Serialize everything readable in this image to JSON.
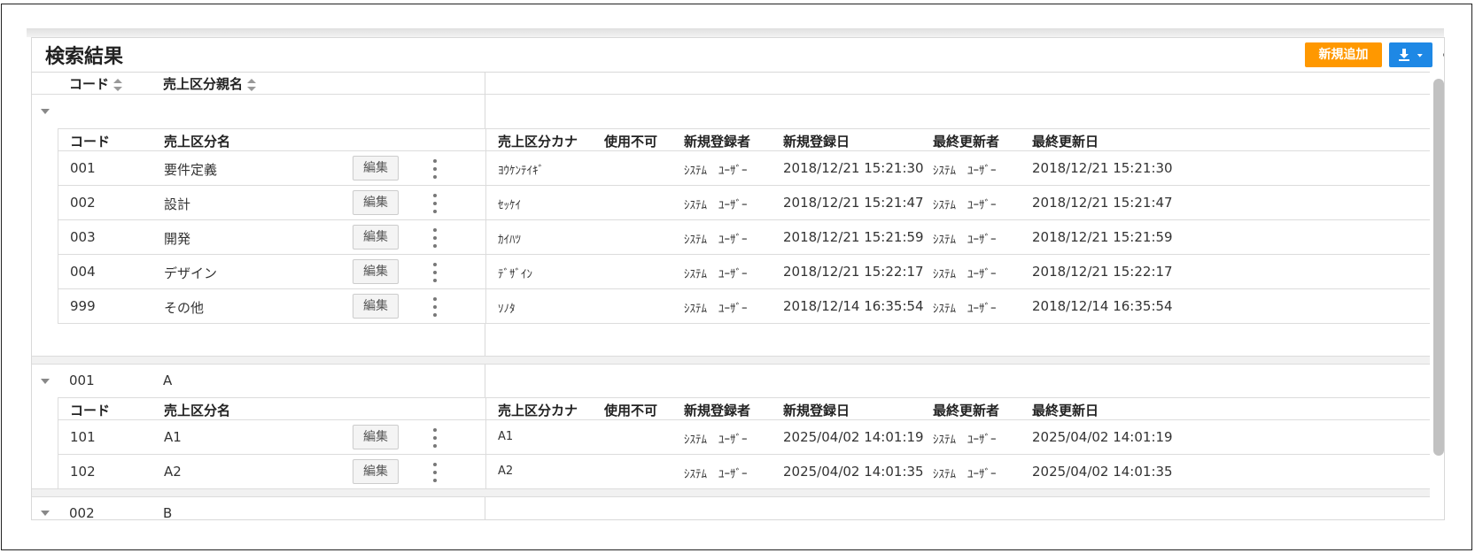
{
  "panel": {
    "title": "検索結果",
    "new_button": "新規追加",
    "download_icon": "download-icon",
    "settings_icon": "gear-icon"
  },
  "master_header": {
    "code": "コード",
    "name": "売上区分親名"
  },
  "detail_header": {
    "code": "コード",
    "name": "売上区分名",
    "kana": "売上区分カナ",
    "disabled": "使用不可",
    "creator": "新規登録者",
    "created": "新規登録日",
    "updater": "最終更新者",
    "updated": "最終更新日"
  },
  "edit_label": "編集",
  "groups": [
    {
      "code": "",
      "name": "",
      "rows": [
        {
          "code": "001",
          "name": "要件定義",
          "kana": "ﾖｳｹﾝﾃｲｷﾞ",
          "creator": "ｼｽﾃﾑ　ﾕｰｻﾞｰ",
          "created": "2018/12/21 15:21:30",
          "updater": "ｼｽﾃﾑ　ﾕｰｻﾞｰ",
          "updated": "2018/12/21 15:21:30"
        },
        {
          "code": "002",
          "name": "設計",
          "kana": "ｾｯｹｲ",
          "creator": "ｼｽﾃﾑ　ﾕｰｻﾞｰ",
          "created": "2018/12/21 15:21:47",
          "updater": "ｼｽﾃﾑ　ﾕｰｻﾞｰ",
          "updated": "2018/12/21 15:21:47"
        },
        {
          "code": "003",
          "name": "開発",
          "kana": "ｶｲﾊﾂ",
          "creator": "ｼｽﾃﾑ　ﾕｰｻﾞｰ",
          "created": "2018/12/21 15:21:59",
          "updater": "ｼｽﾃﾑ　ﾕｰｻﾞｰ",
          "updated": "2018/12/21 15:21:59"
        },
        {
          "code": "004",
          "name": "デザイン",
          "kana": "ﾃﾞｻﾞｲﾝ",
          "creator": "ｼｽﾃﾑ　ﾕｰｻﾞｰ",
          "created": "2018/12/21 15:22:17",
          "updater": "ｼｽﾃﾑ　ﾕｰｻﾞｰ",
          "updated": "2018/12/21 15:22:17"
        },
        {
          "code": "999",
          "name": "その他",
          "kana": "ｿﾉﾀ",
          "creator": "ｼｽﾃﾑ　ﾕｰｻﾞｰ",
          "created": "2018/12/14 16:35:54",
          "updater": "ｼｽﾃﾑ　ﾕｰｻﾞｰ",
          "updated": "2018/12/14 16:35:54"
        }
      ]
    },
    {
      "code": "001",
      "name": "A",
      "rows": [
        {
          "code": "101",
          "name": "A1",
          "kana": "A1",
          "creator": "ｼｽﾃﾑ　ﾕｰｻﾞｰ",
          "created": "2025/04/02 14:01:19",
          "updater": "ｼｽﾃﾑ　ﾕｰｻﾞｰ",
          "updated": "2025/04/02 14:01:19"
        },
        {
          "code": "102",
          "name": "A2",
          "kana": "A2",
          "creator": "ｼｽﾃﾑ　ﾕｰｻﾞｰ",
          "created": "2025/04/02 14:01:35",
          "updater": "ｼｽﾃﾑ　ﾕｰｻﾞｰ",
          "updated": "2025/04/02 14:01:35"
        }
      ]
    },
    {
      "code": "002",
      "name": "B",
      "rows": []
    }
  ]
}
